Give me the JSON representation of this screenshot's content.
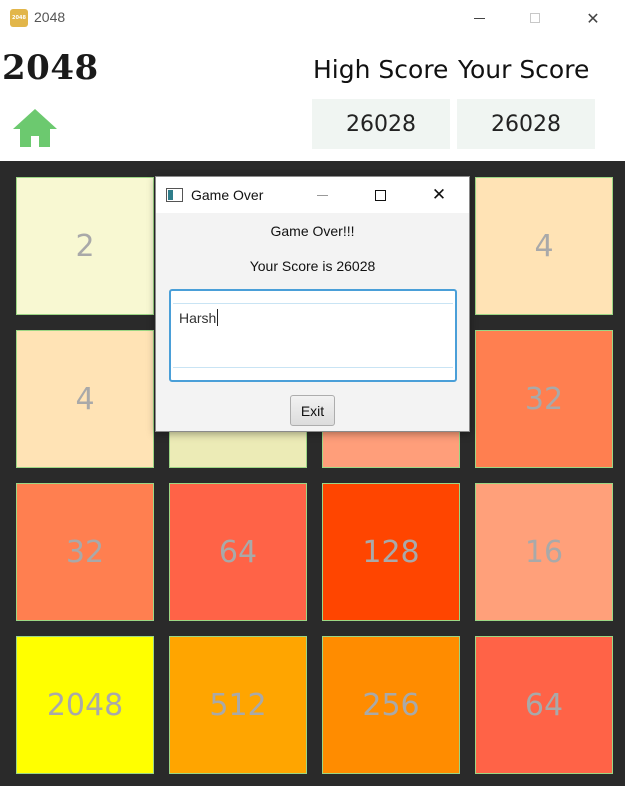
{
  "window": {
    "title": "2048",
    "app_icon_text": "2048"
  },
  "header": {
    "game_title": "2048",
    "high_score_label": "High Score",
    "your_score_label": "Your Score",
    "high_score": "26028",
    "your_score": "26028",
    "home_icon": "home-icon",
    "home_icon_color": "#6cc96f"
  },
  "board": {
    "tiles": [
      {
        "value": "2",
        "bg": "#f8f8d2"
      },
      {
        "value": "",
        "bg": "#f8f8d2"
      },
      {
        "value": "",
        "bg": "#f8f8d2"
      },
      {
        "value": "4",
        "bg": "#ffe3b5"
      },
      {
        "value": "4",
        "bg": "#ffe3b5"
      },
      {
        "value": "",
        "bg": "#ecebb6"
      },
      {
        "value": "",
        "bg": "#ff9e7a"
      },
      {
        "value": "32",
        "bg": "#ff7f50"
      },
      {
        "value": "32",
        "bg": "#ff7f50"
      },
      {
        "value": "64",
        "bg": "#ff6347"
      },
      {
        "value": "128",
        "bg": "#ff4500"
      },
      {
        "value": "16",
        "bg": "#ffa07a"
      },
      {
        "value": "2048",
        "bg": "#ffff00"
      },
      {
        "value": "512",
        "bg": "#ffa500"
      },
      {
        "value": "256",
        "bg": "#ff8c00"
      },
      {
        "value": "64",
        "bg": "#ff6347"
      }
    ]
  },
  "dialog": {
    "title": "Game Over",
    "message": "Game Over!!!",
    "score_text": "Your Score is 26028",
    "name_value": "Harsh",
    "exit_label": "Exit"
  }
}
